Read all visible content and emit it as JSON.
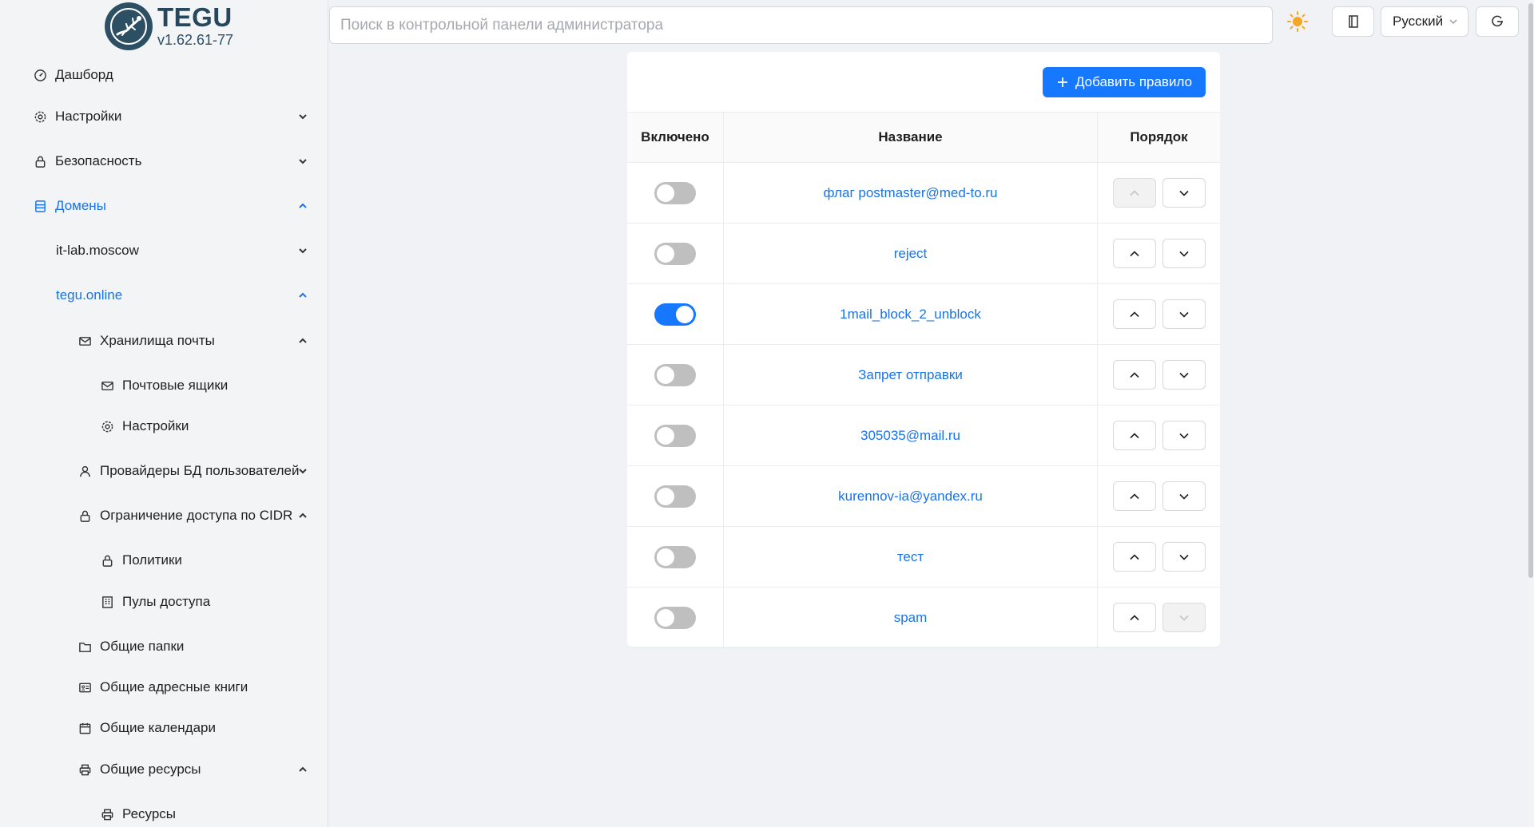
{
  "app": {
    "name": "TEGU",
    "version": "v1.62.61-77"
  },
  "search": {
    "placeholder": "Поиск в контрольной панели администратора"
  },
  "header": {
    "language": "Русский"
  },
  "sidebar": {
    "items": [
      {
        "label": "Дашборд",
        "icon": "dashboard-icon"
      },
      {
        "label": "Настройки",
        "icon": "gear-icon",
        "chevron": "down"
      },
      {
        "label": "Безопасность",
        "icon": "lock-icon",
        "chevron": "down"
      },
      {
        "label": "Домены",
        "icon": "database-icon",
        "chevron": "up",
        "active": true
      },
      {
        "label": "it-lab.moscow",
        "chevron": "down"
      },
      {
        "label": "tegu.online",
        "chevron": "up",
        "active": true
      },
      {
        "label": "Хранилища почты",
        "icon": "mail-icon",
        "chevron": "up"
      },
      {
        "label": "Почтовые ящики",
        "icon": "mail-icon"
      },
      {
        "label": "Настройки",
        "icon": "gear-icon"
      },
      {
        "label": "Провайдеры БД пользователей",
        "icon": "user-icon",
        "chevron": "down"
      },
      {
        "label": "Ограничение доступа по CIDR",
        "icon": "lock-icon",
        "chevron": "up"
      },
      {
        "label": "Политики",
        "icon": "lock-icon"
      },
      {
        "label": "Пулы доступа",
        "icon": "building-icon"
      },
      {
        "label": "Общие папки",
        "icon": "folder-icon"
      },
      {
        "label": "Общие адресные книги",
        "icon": "contact-card-icon"
      },
      {
        "label": "Общие календари",
        "icon": "calendar-icon"
      },
      {
        "label": "Общие ресурсы",
        "icon": "printer-icon",
        "chevron": "up"
      },
      {
        "label": "Ресурсы",
        "icon": "printer-icon"
      }
    ]
  },
  "toolbar": {
    "add_rule_label": "Добавить правило"
  },
  "table": {
    "columns": [
      "Включено",
      "Название",
      "Порядок"
    ],
    "rows": [
      {
        "enabled": false,
        "name": "флаг postmaster@med-to.ru",
        "up_disabled": true,
        "down_disabled": false
      },
      {
        "enabled": false,
        "name": "reject",
        "up_disabled": false,
        "down_disabled": false
      },
      {
        "enabled": true,
        "name": "1mail_block_2_unblock",
        "up_disabled": false,
        "down_disabled": false
      },
      {
        "enabled": false,
        "name": "Запрет отправки",
        "up_disabled": false,
        "down_disabled": false
      },
      {
        "enabled": false,
        "name": "305035@mail.ru",
        "up_disabled": false,
        "down_disabled": false
      },
      {
        "enabled": false,
        "name": "kurennov-ia@yandex.ru",
        "up_disabled": false,
        "down_disabled": false
      },
      {
        "enabled": false,
        "name": "тест",
        "up_disabled": false,
        "down_disabled": false
      },
      {
        "enabled": false,
        "name": "spam",
        "up_disabled": false,
        "down_disabled": true
      }
    ]
  },
  "colors": {
    "accent": "#1677ff",
    "link": "#1a73e8",
    "sidebar_bg": "#f3f4f6",
    "logo": "#2d4f63"
  }
}
